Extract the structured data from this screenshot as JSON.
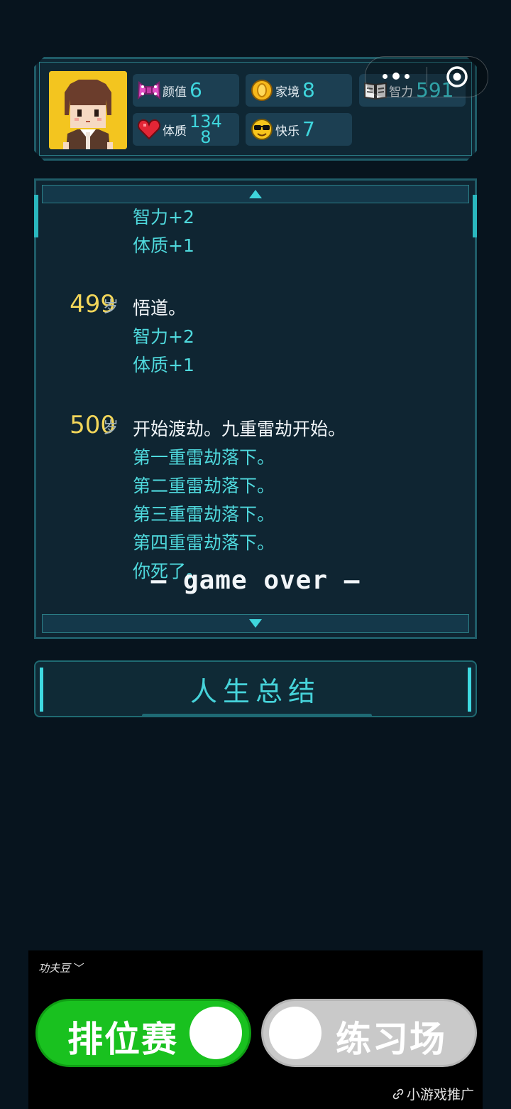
{
  "stats": {
    "charm": {
      "label": "颜值",
      "value": "6",
      "icon": "bow-icon"
    },
    "family": {
      "label": "家境",
      "value": "8",
      "icon": "coin-icon"
    },
    "intelligence": {
      "label": "智力",
      "value": "591",
      "icon": "book-icon"
    },
    "physique": {
      "label": "体质",
      "value_line1": "134",
      "value_line2": "8",
      "icon": "heart-icon"
    },
    "happiness": {
      "label": "快乐",
      "value": "7",
      "icon": "sunglasses-emoji-icon"
    }
  },
  "capsule": {
    "more_icon": "more-dots-icon",
    "close_icon": "target-close-icon"
  },
  "log": {
    "top_lines": [
      "智力+2",
      "体质+1"
    ],
    "entries": [
      {
        "age": "499",
        "unit": "岁",
        "main": "悟道。",
        "subs": [
          "智力+2",
          "体质+1"
        ]
      },
      {
        "age": "500",
        "unit": "岁",
        "main": "开始渡劫。九重雷劫开始。",
        "subs": [
          "第一重雷劫落下。",
          "第二重雷劫落下。",
          "第三重雷劫落下。",
          "第四重雷劫落下。",
          "你死了。"
        ]
      }
    ],
    "game_over": "— game over —"
  },
  "summary_button": {
    "label": "人生总结"
  },
  "ad": {
    "logo": "功夫豆",
    "toggle_ranked": "排位赛",
    "toggle_practice": "练习场",
    "footer": "小游戏推广"
  },
  "colors": {
    "background": "#07141e",
    "panel": "#0f2532",
    "accent_cyan": "#4fd9dd",
    "age_yellow": "#f2d65a",
    "toggle_green": "#19c11f"
  }
}
